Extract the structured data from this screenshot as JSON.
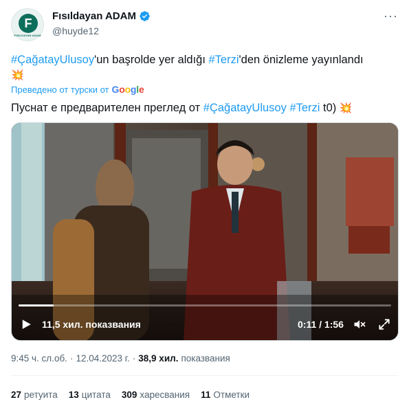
{
  "author": {
    "display_name": "Fısıldayan ADAM",
    "handle": "@huyde12",
    "avatar_letter": "F",
    "avatar_caption": "FISILDAYAN ADAM",
    "verified_color": "#1d9bf0"
  },
  "tweet": {
    "hashtag1": "#ÇağatayUlusoy",
    "text1": "'un başrolde yer aldığı ",
    "hashtag2": "#Terzi",
    "text2": "'den önizleme yayınlandı",
    "emoji": "💥"
  },
  "translation": {
    "notice": "Преведено от турски от",
    "provider": [
      "G",
      "o",
      "o",
      "g",
      "l",
      "e"
    ],
    "text1": "Пуснат е предварителен преглед от ",
    "hashtag1": "#ÇağatayUlusoy",
    "hashtag2": "#Terzi",
    "text2": " t0) ",
    "emoji": "💥"
  },
  "video": {
    "views_label": "11,5 хил. показвания",
    "time_label": "0:11 / 1:56",
    "progress": 0.095
  },
  "meta": {
    "time": "9:45 ч. сл.об.",
    "sep": "·",
    "date": "12.04.2023 г.",
    "sep2": "·",
    "views_count": "38,9 хил.",
    "views_label": "показвания"
  },
  "stats": {
    "retweets_count": "27",
    "retweets_label": "ретуита",
    "quotes_count": "13",
    "quotes_label": "цитата",
    "likes_count": "309",
    "likes_label": "харесвания",
    "bookmarks_count": "11",
    "bookmarks_label": "Отметки"
  }
}
